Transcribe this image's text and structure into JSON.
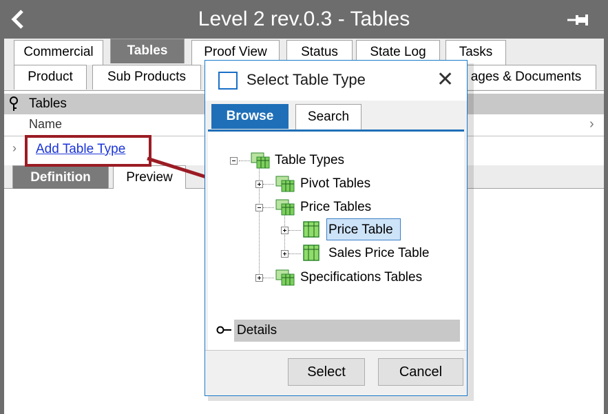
{
  "window": {
    "title": "Level 2 rev.0.3 - Tables",
    "back_icon": "chevron-left-icon",
    "pin_icon": "pin-icon"
  },
  "tabs_row1": [
    "Commercial",
    "Tables",
    "Proof View",
    "Status",
    "State Log",
    "Tasks"
  ],
  "tabs_row2": [
    "Product",
    "Sub Products",
    "ages & Documents"
  ],
  "active_tab": "Tables",
  "tables_pane": {
    "header": "Tables",
    "column_name": "Name",
    "add_link": "Add Table Type"
  },
  "sub_tabs": [
    "Definition",
    "Preview"
  ],
  "dialog": {
    "title": "Select Table Type",
    "tabs": [
      "Browse",
      "Search"
    ],
    "tree": {
      "root": "Table Types",
      "pivot": "Pivot Tables",
      "price": "Price Tables",
      "price_table": "Price Table",
      "sales_price_table": "Sales Price Table",
      "specifications": "Specifications Tables"
    },
    "selected_item": "Price Table",
    "details_label": "Details",
    "select_button": "Select",
    "cancel_button": "Cancel"
  },
  "colors": {
    "accent": "#1f6fb8",
    "titlebar": "#6d6d6d",
    "highlight": "#9b1c24",
    "link": "#1a34d8"
  }
}
